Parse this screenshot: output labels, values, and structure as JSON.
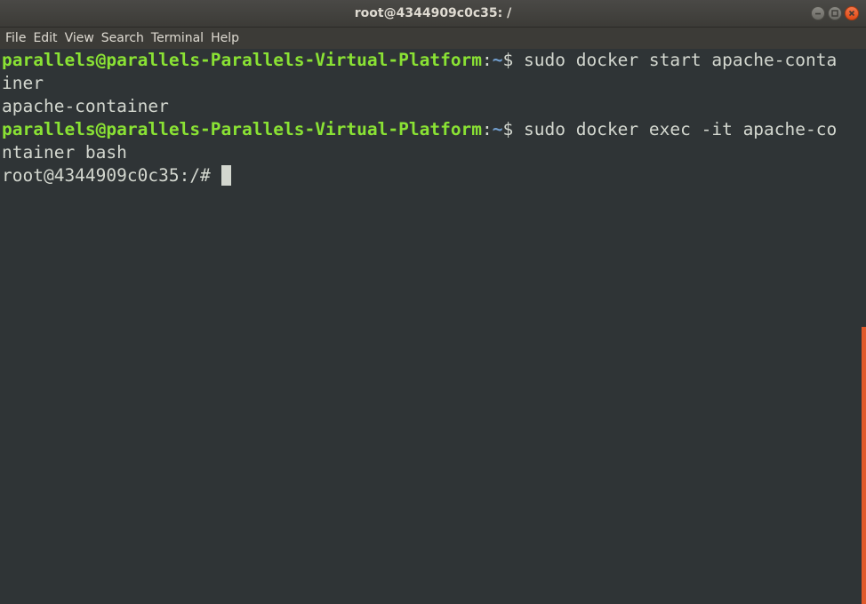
{
  "window": {
    "title": "root@4344909c0c35: /"
  },
  "menu": {
    "items": [
      "File",
      "Edit",
      "View",
      "Search",
      "Terminal",
      "Help"
    ]
  },
  "terminal": {
    "prompt_user": "parallels@parallels-Parallels-Virtual-Platform",
    "prompt_colon": ":",
    "prompt_path": "~",
    "line1_cmd": "$ sudo docker start apache-conta",
    "line2": "iner",
    "line3": "apache-container",
    "line4_cmd": "$ sudo docker exec -it apache-co",
    "line5": "ntainer bash",
    "root_prompt": "root@4344909c0c35:/# "
  },
  "colors": {
    "background": "#2f3436",
    "prompt_user": "#8ae234",
    "prompt_path": "#729fcf",
    "text": "#d3d7cf",
    "scrollbar": "#e05a2b",
    "close_button": "#df4a16"
  },
  "icons": {
    "minimize": "minimize-icon",
    "maximize": "maximize-icon",
    "close": "close-icon"
  }
}
